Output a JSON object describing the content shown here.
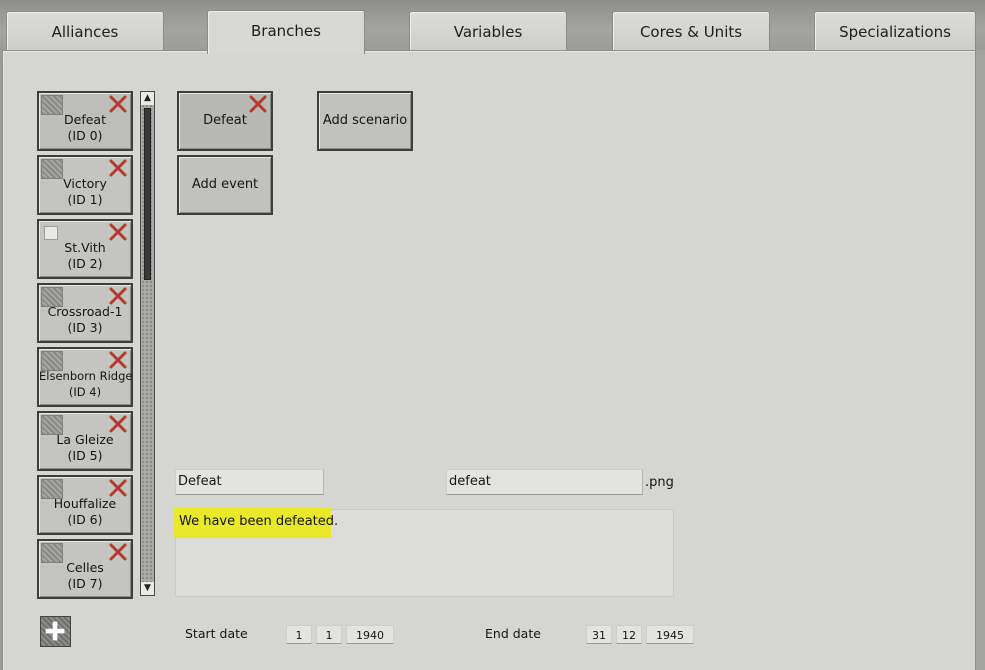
{
  "tabs": [
    "Alliances",
    "Branches",
    "Variables",
    "Cores & Units",
    "Specializations"
  ],
  "branches": [
    {
      "name": "Defeat",
      "id": "(ID 0)"
    },
    {
      "name": "Victory",
      "id": "(ID 1)"
    },
    {
      "name": "St.Vith",
      "id": "(ID 2)"
    },
    {
      "name": "Crossroad-1",
      "id": "(ID 3)"
    },
    {
      "name": "Elsenborn Ridge",
      "id": "(ID 4)"
    },
    {
      "name": "La Gleize",
      "id": "(ID 5)"
    },
    {
      "name": "Houffalize",
      "id": "(ID 6)"
    },
    {
      "name": "Celles",
      "id": "(ID 7)"
    }
  ],
  "selected_event": "Defeat",
  "buttons": {
    "add_scenario": "Add scenario",
    "add_event": "Add event"
  },
  "fields": {
    "name_value": "Defeat",
    "image_value": "defeat",
    "image_ext": ".png",
    "description": "We have been defeated."
  },
  "dates": {
    "start_label": "Start date",
    "start": [
      "1",
      "1",
      "1940"
    ],
    "end_label": "End date",
    "end": [
      "31",
      "12",
      "1945"
    ]
  },
  "colors": {
    "highlight": "#e9e92a",
    "delete_x": "#b53a2e"
  },
  "icons": {
    "delete": "x-icon",
    "add": "plus-icon",
    "scroll_up": "arrow-up-icon",
    "scroll_down": "arrow-down-icon"
  }
}
